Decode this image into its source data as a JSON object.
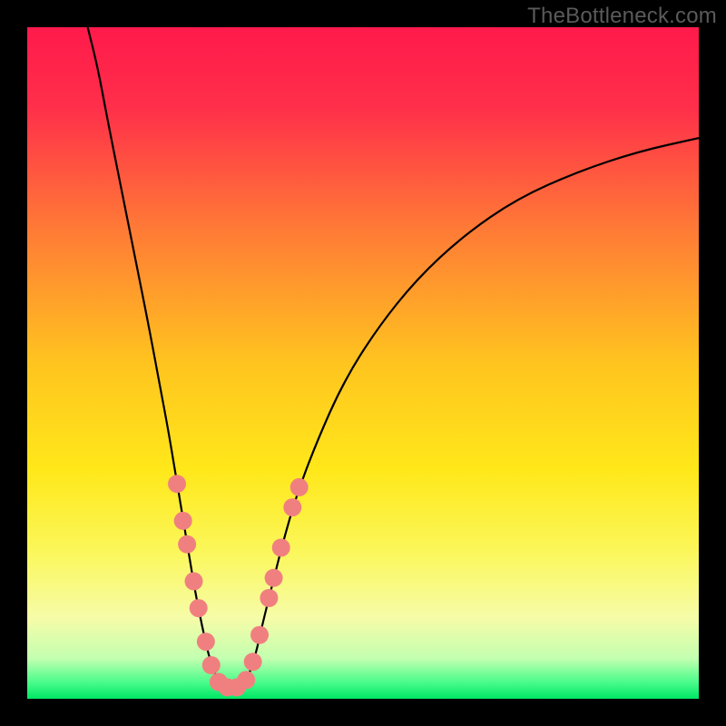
{
  "watermark": "TheBottleneck.com",
  "chart_data": {
    "type": "line",
    "title": "",
    "xlabel": "",
    "ylabel": "",
    "xlim": [
      0,
      100
    ],
    "ylim": [
      0,
      100
    ],
    "grid": false,
    "legend": false,
    "background": {
      "type": "vertical-gradient",
      "stops": [
        {
          "offset": 0.0,
          "color": "#ff1a4b"
        },
        {
          "offset": 0.12,
          "color": "#ff2f4a"
        },
        {
          "offset": 0.3,
          "color": "#ff7a36"
        },
        {
          "offset": 0.5,
          "color": "#ffc41f"
        },
        {
          "offset": 0.66,
          "color": "#ffe81a"
        },
        {
          "offset": 0.78,
          "color": "#fbf75a"
        },
        {
          "offset": 0.88,
          "color": "#f6fca8"
        },
        {
          "offset": 0.94,
          "color": "#c3ffb0"
        },
        {
          "offset": 0.975,
          "color": "#4bfc8b"
        },
        {
          "offset": 1.0,
          "color": "#00e765"
        }
      ]
    },
    "series": [
      {
        "name": "bottleneck-curve",
        "note": "Percentage values approximate; y = % height from bottom, x = % from left",
        "points": [
          {
            "x": 9.0,
            "y": 100.0
          },
          {
            "x": 10.5,
            "y": 94.0
          },
          {
            "x": 12.0,
            "y": 86.0
          },
          {
            "x": 14.0,
            "y": 76.0
          },
          {
            "x": 16.0,
            "y": 66.0
          },
          {
            "x": 18.0,
            "y": 56.0
          },
          {
            "x": 19.5,
            "y": 48.0
          },
          {
            "x": 21.0,
            "y": 40.0
          },
          {
            "x": 22.0,
            "y": 34.0
          },
          {
            "x": 23.0,
            "y": 28.0
          },
          {
            "x": 24.0,
            "y": 22.0
          },
          {
            "x": 25.0,
            "y": 16.0
          },
          {
            "x": 26.0,
            "y": 11.0
          },
          {
            "x": 27.0,
            "y": 6.5
          },
          {
            "x": 28.0,
            "y": 3.5
          },
          {
            "x": 29.0,
            "y": 2.0
          },
          {
            "x": 30.0,
            "y": 1.5
          },
          {
            "x": 31.0,
            "y": 1.5
          },
          {
            "x": 32.0,
            "y": 2.0
          },
          {
            "x": 33.0,
            "y": 3.5
          },
          {
            "x": 34.0,
            "y": 6.5
          },
          {
            "x": 35.0,
            "y": 11.0
          },
          {
            "x": 36.5,
            "y": 17.0
          },
          {
            "x": 38.0,
            "y": 23.0
          },
          {
            "x": 40.0,
            "y": 30.0
          },
          {
            "x": 43.0,
            "y": 38.0
          },
          {
            "x": 47.0,
            "y": 47.0
          },
          {
            "x": 52.0,
            "y": 55.0
          },
          {
            "x": 58.0,
            "y": 62.5
          },
          {
            "x": 65.0,
            "y": 69.0
          },
          {
            "x": 73.0,
            "y": 74.5
          },
          {
            "x": 82.0,
            "y": 78.5
          },
          {
            "x": 91.0,
            "y": 81.5
          },
          {
            "x": 100.0,
            "y": 83.5
          }
        ]
      }
    ],
    "markers": {
      "name": "highlight-dots",
      "color": "#f08080",
      "radius_pct": 1.35,
      "points": [
        {
          "x": 22.3,
          "y": 32.0
        },
        {
          "x": 23.2,
          "y": 26.5
        },
        {
          "x": 23.8,
          "y": 23.0
        },
        {
          "x": 24.8,
          "y": 17.5
        },
        {
          "x": 25.5,
          "y": 13.5
        },
        {
          "x": 26.6,
          "y": 8.5
        },
        {
          "x": 27.4,
          "y": 5.0
        },
        {
          "x": 28.5,
          "y": 2.5
        },
        {
          "x": 29.8,
          "y": 1.7
        },
        {
          "x": 31.2,
          "y": 1.7
        },
        {
          "x": 32.6,
          "y": 2.8
        },
        {
          "x": 33.6,
          "y": 5.5
        },
        {
          "x": 34.6,
          "y": 9.5
        },
        {
          "x": 36.0,
          "y": 15.0
        },
        {
          "x": 36.7,
          "y": 18.0
        },
        {
          "x": 37.8,
          "y": 22.5
        },
        {
          "x": 39.5,
          "y": 28.5
        },
        {
          "x": 40.5,
          "y": 31.5
        }
      ]
    }
  }
}
